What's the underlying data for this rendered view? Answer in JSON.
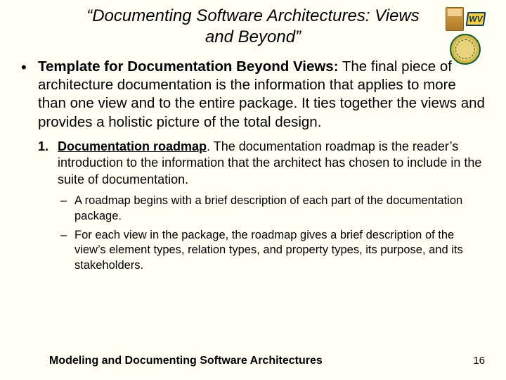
{
  "title": "“Documenting Software Architectures: Views and Beyond”",
  "logos": {
    "wv": "WV"
  },
  "bullet": {
    "lead": "Template for Documentation Beyond Views:",
    "rest": " The final piece of architecture documentation is the information that applies to more than one view and to the entire package. It ties together the views and provides a holistic picture of the total design."
  },
  "numbered": {
    "index": "1.",
    "lead": "Documentation roadmap",
    "rest": ". The documentation roadmap is the reader’s introduction to the information that the architect has chosen to include in the suite of documentation."
  },
  "dashes": [
    "A roadmap begins with a brief description of each part of the documentation package.",
    "For each view in the package, the roadmap gives a brief description of the view’s element types, relation types, and property types, its purpose, and its stakeholders."
  ],
  "footer": {
    "title": "Modeling and Documenting Software Architectures",
    "page": "16"
  }
}
